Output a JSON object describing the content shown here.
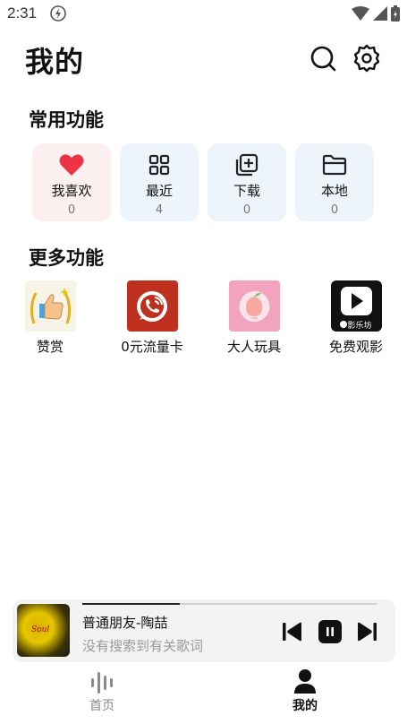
{
  "status": {
    "time": "2:31",
    "icons": [
      "bolt-icon",
      "wifi-icon",
      "signal-icon",
      "battery-icon"
    ]
  },
  "header": {
    "title": "我的",
    "icons": [
      "search-icon",
      "gear-icon"
    ]
  },
  "common": {
    "title": "常用功能",
    "items": [
      {
        "label": "我喜欢",
        "count": "0",
        "icon": "heart-icon",
        "color": "#ee3344"
      },
      {
        "label": "最近",
        "count": "4",
        "icon": "grid-icon",
        "color": "#222222"
      },
      {
        "label": "下载",
        "count": "0",
        "icon": "download-icon",
        "color": "#222222"
      },
      {
        "label": "本地",
        "count": "0",
        "icon": "folder-icon",
        "color": "#222222"
      }
    ]
  },
  "more": {
    "title": "更多功能",
    "items": [
      {
        "label": "赞赏",
        "icon": "thumbs-up-icon"
      },
      {
        "label": "0元流量卡",
        "icon": "phone-call-icon"
      },
      {
        "label": "大人玩具",
        "icon": "peach-icon"
      },
      {
        "label": "免费观影",
        "icon": "play-icon",
        "badge": "影乐坊"
      }
    ]
  },
  "player": {
    "title": "普通朋友-陶喆",
    "lyric": "没有搜索到有关歌词",
    "progress": 0.33,
    "cover_text": "Soul",
    "controls": [
      "previous-icon",
      "pause-icon",
      "next-icon"
    ]
  },
  "nav": {
    "items": [
      {
        "label": "首页",
        "icon": "wave-icon",
        "active": false
      },
      {
        "label": "我的",
        "icon": "user-icon",
        "active": true
      }
    ]
  },
  "colors": {
    "accent": "#111111",
    "card_bg": "#edf4fc",
    "fav_bg": "#fdf0f0",
    "inactive": "#8a8a8a"
  }
}
